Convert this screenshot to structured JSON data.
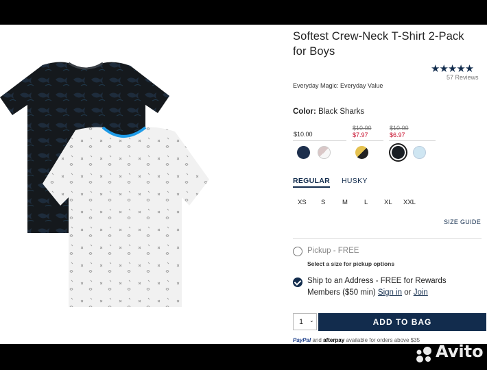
{
  "product": {
    "title": "Softest Crew-Neck T-Shirt 2-Pack for Boys",
    "stars": "★★★★★",
    "reviews": "57 Reviews",
    "value_label": "Everyday Magic: Everyday Value",
    "rating_color": "#122c4d"
  },
  "color": {
    "label": "Color:",
    "value": "Black Sharks"
  },
  "prices": [
    {
      "regular": "",
      "price": "$10.00"
    },
    {
      "regular": "$10.00",
      "price": "$7.97"
    },
    {
      "regular": "$10.00",
      "price": "$6.97"
    }
  ],
  "swatches": [
    "navy",
    "pink-white",
    "yellow-black",
    "black-sharks",
    "light-blue-print"
  ],
  "size_tabs": [
    "REGULAR",
    "HUSKY"
  ],
  "sizes": [
    "XS",
    "S",
    "M",
    "L",
    "XL",
    "XXL"
  ],
  "size_guide": "SIZE GUIDE",
  "fulfillment": {
    "pickup_label": "Pickup - FREE",
    "pickup_note": "Select a size for pickup options",
    "ship_label_line1": "Ship to an Address - FREE for Rewards",
    "ship_label_line2": "Members ($50 min)",
    "sign_in": "Sign in",
    "or": "or",
    "join": "Join"
  },
  "cart": {
    "quantity": "1",
    "add_to_bag": "ADD TO BAG"
  },
  "payment": {
    "paypal": "PayPal",
    "and": "and",
    "afterpay": "afterpay",
    "note": "available for orders above $35"
  },
  "watermark": "Avito",
  "brand_color": "#122c4d",
  "sale_color": "#c8102e"
}
